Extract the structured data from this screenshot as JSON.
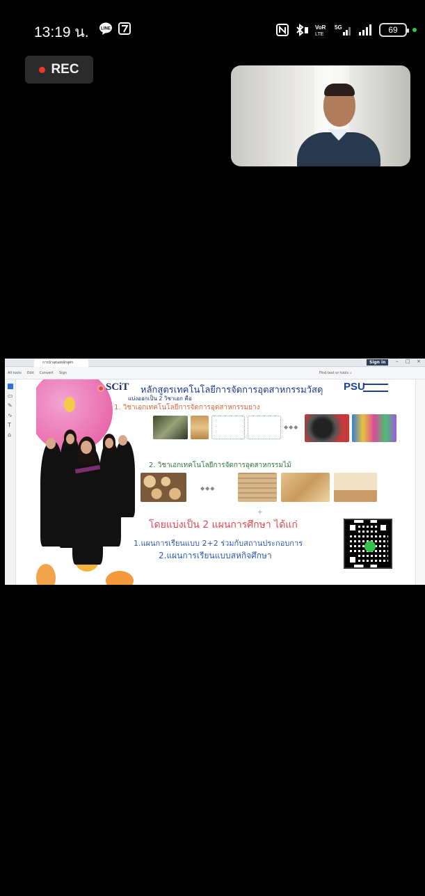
{
  "status_bar": {
    "time": "13:19 น.",
    "battery": "69",
    "network_label": "5G",
    "volte_label": "VoLTE"
  },
  "recording": {
    "label": "REC",
    "dot_color": "#e8392f"
  },
  "camera": {
    "icon": "participant-video"
  },
  "browser": {
    "tab_title": "การนำเสนอหลักสูตร",
    "sign_in": "Sign in",
    "menu_items": [
      "All tools",
      "Edit",
      "Convert",
      "Sign"
    ],
    "find_label": "Find text or tools"
  },
  "slide": {
    "logo_text": "SCiT",
    "title": "หลักสูตรเทคโนโลยีการจัดการอุตสาหกรรมวัสดุ",
    "university_logo": "PSU",
    "subtitle": "แบ่งออกเป็น 2 วิชาเอก คือ",
    "major_1": "1. วิชาเอกเทคโนโลยีการจัดการอุตสาหกรรมยาง",
    "major_2": "2. วิชาเอกเทคโนโลยีการจัดการอุตสาหกรรมไม้",
    "plans_title": "โดยแบ่งเป็น 2 แผนการศึกษา ได้แก่",
    "plan_1": "1.แผนการเรียนแบบ 2+2 ร่วมกับสถานประกอบการ",
    "plan_2": "2.แผนการเรียนแบบสหกิจศึกษา",
    "arrows": "◆◆◆",
    "plus": "+"
  }
}
